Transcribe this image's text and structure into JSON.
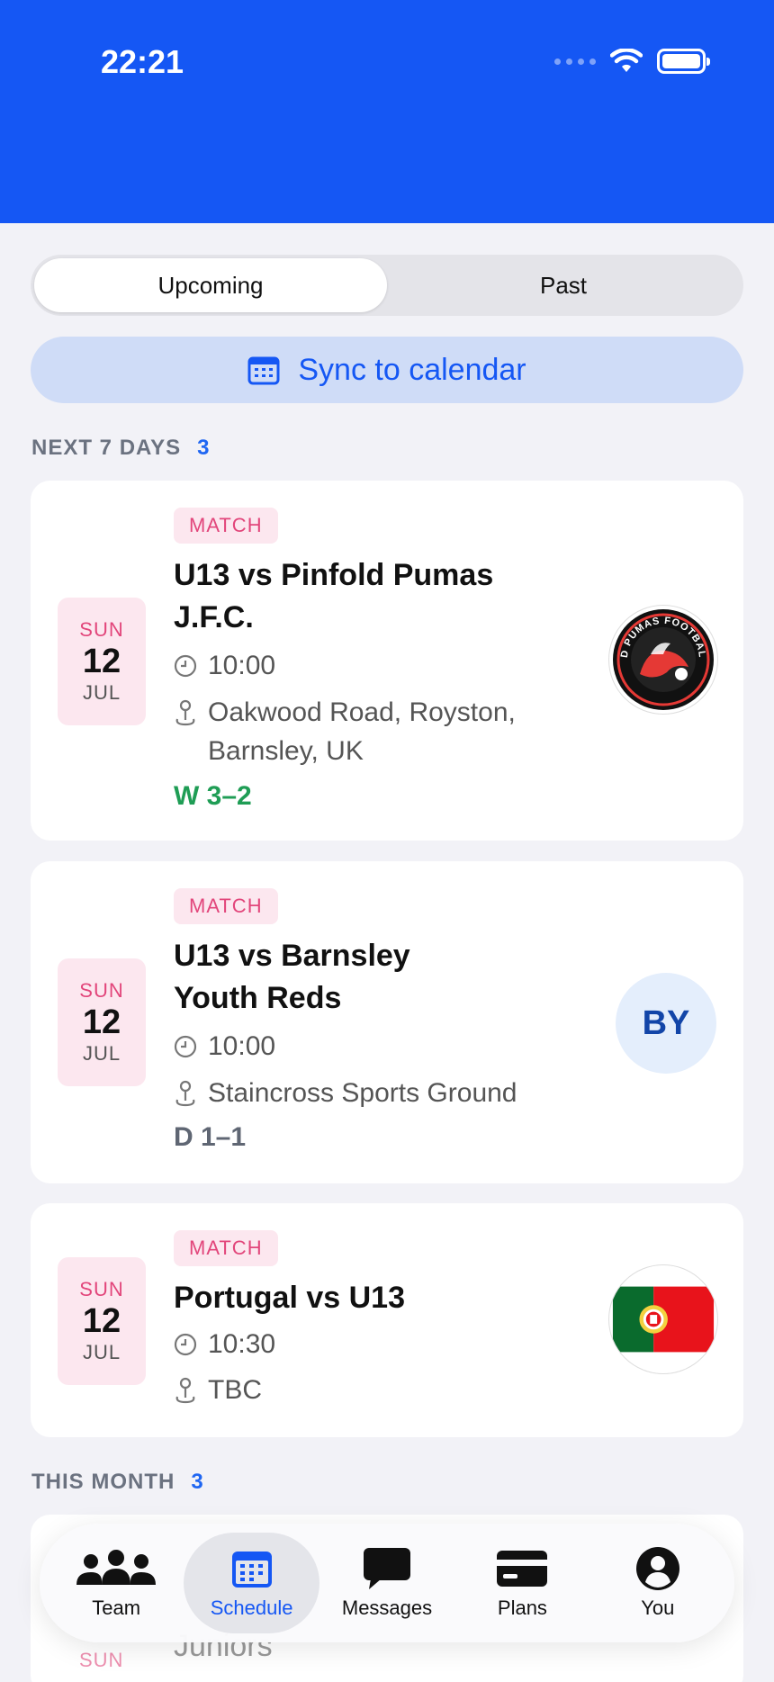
{
  "status_bar": {
    "time": "22:21"
  },
  "segmented": {
    "upcoming": "Upcoming",
    "past": "Past"
  },
  "sync": {
    "label": "Sync to calendar"
  },
  "next_7_days": {
    "label": "NEXT 7 DAYS",
    "count": "3"
  },
  "this_month": {
    "label": "THIS MONTH",
    "count": "3"
  },
  "events": [
    {
      "tag": "MATCH",
      "dow": "SUN",
      "day": "12",
      "month": "JUL",
      "title": "U13 vs Pinfold Pumas J.F.C.",
      "time": "10:00",
      "location": "Oakwood Road, Royston, Barnsley, UK",
      "result": "W 3–2",
      "result_color": "#1f9d55",
      "badge_text": "PINFOLD PUMAS FOOTBALL CLUB"
    },
    {
      "tag": "MATCH",
      "dow": "SUN",
      "day": "12",
      "month": "JUL",
      "title": "U13 vs Barnsley Youth Reds",
      "time": "10:00",
      "location": "Staincross Sports Ground",
      "result": "D 1–1",
      "result_color": "#5f6673",
      "badge_text": "BY"
    },
    {
      "tag": "MATCH",
      "dow": "SUN",
      "day": "12",
      "month": "JUL",
      "title": "Portugal vs U13",
      "time": "10:30",
      "location": "TBC"
    }
  ],
  "ghost": {
    "title": "Juniors",
    "dow": "SUN"
  },
  "tabs": [
    {
      "label": "Team",
      "icon": "team-icon"
    },
    {
      "label": "Schedule",
      "icon": "calendar-icon"
    },
    {
      "label": "Messages",
      "icon": "chat-bubble-icon"
    },
    {
      "label": "Plans",
      "icon": "credit-card-icon"
    },
    {
      "label": "You",
      "icon": "person-icon"
    }
  ],
  "colors": {
    "brand": "#1557f4",
    "match_tag": "#e2467b",
    "win": "#1f9d55",
    "draw": "#5f6673"
  }
}
